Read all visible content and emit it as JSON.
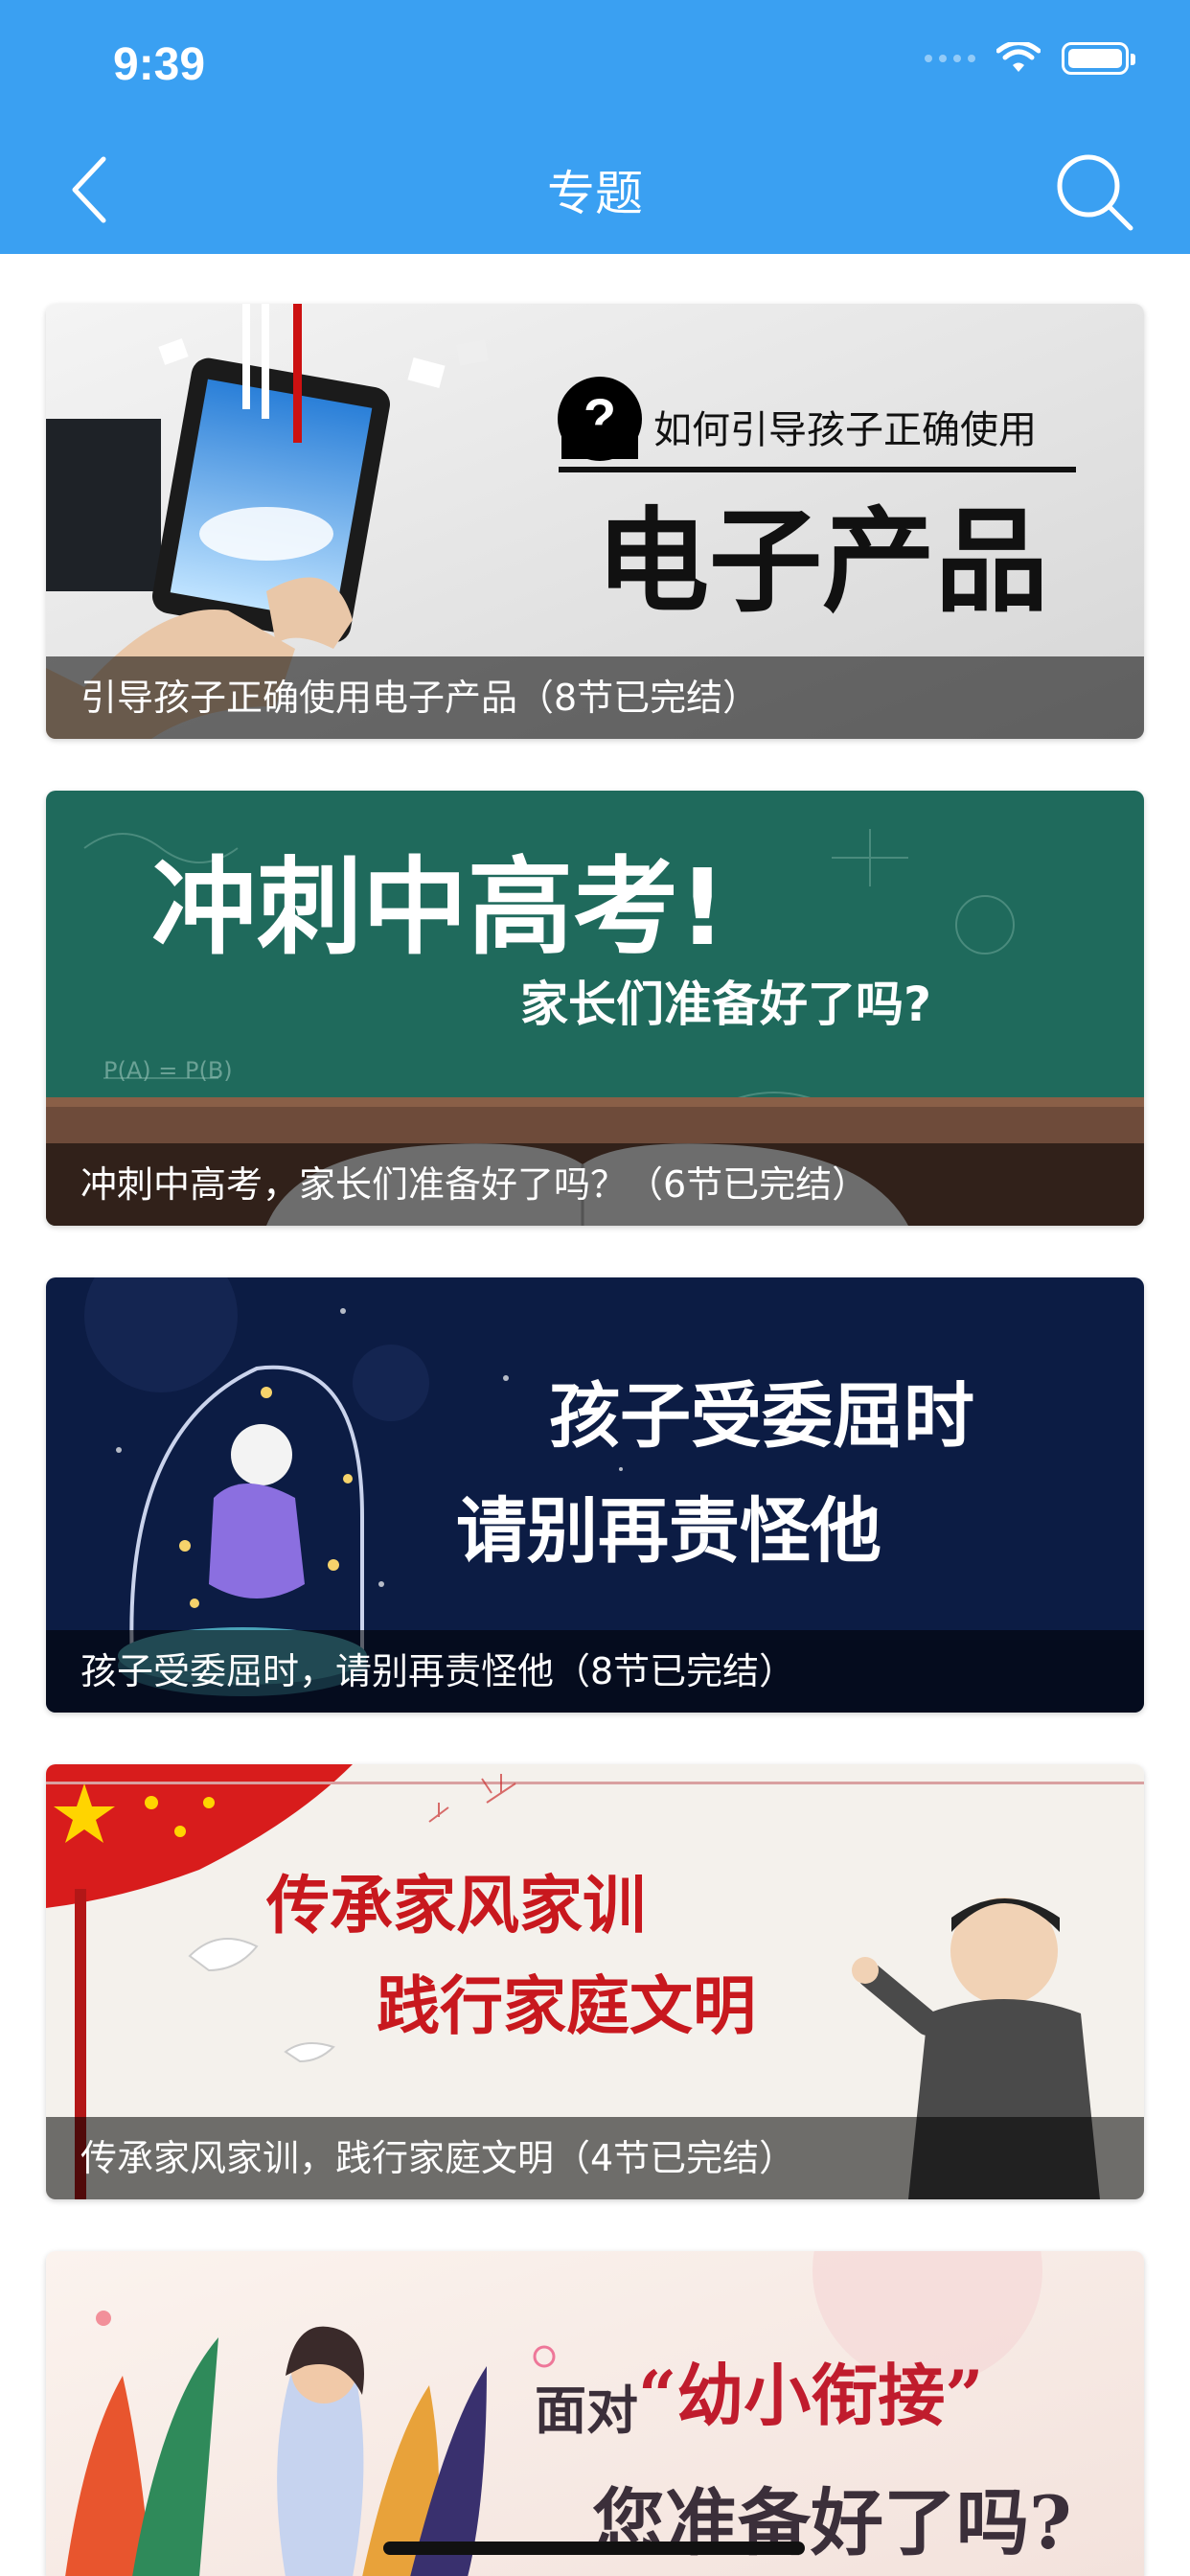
{
  "status_bar": {
    "time": "9:39"
  },
  "header": {
    "title": "专题",
    "back_icon": "chevron-left-icon",
    "search_icon": "search-icon"
  },
  "colors": {
    "header_bg": "#3aa0f2",
    "caption_bg": "rgba(0,0,0,0.55)"
  },
  "topics": [
    {
      "caption": "引导孩子正确使用电子产品（8节已完结）",
      "banner_subtitle": "如何引导孩子正确使用",
      "banner_title": "电子产品"
    },
    {
      "caption": "冲刺中高考，家长们准备好了吗？（6节已完结）",
      "banner_title": "冲刺中高考!",
      "banner_subtitle": "家长们准备好了吗?"
    },
    {
      "caption": "孩子受委屈时，请别再责怪他（8节已完结）",
      "banner_line1": "孩子受委屈时",
      "banner_line2": "请别再责怪他"
    },
    {
      "caption": "传承家风家训，践行家庭文明（4节已完结）",
      "banner_line1": "传承家风家训",
      "banner_line2": "践行家庭文明"
    },
    {
      "banner_prefix": "面对",
      "banner_title": "“幼小衔接”",
      "banner_line2": "您准备好了吗?"
    }
  ]
}
